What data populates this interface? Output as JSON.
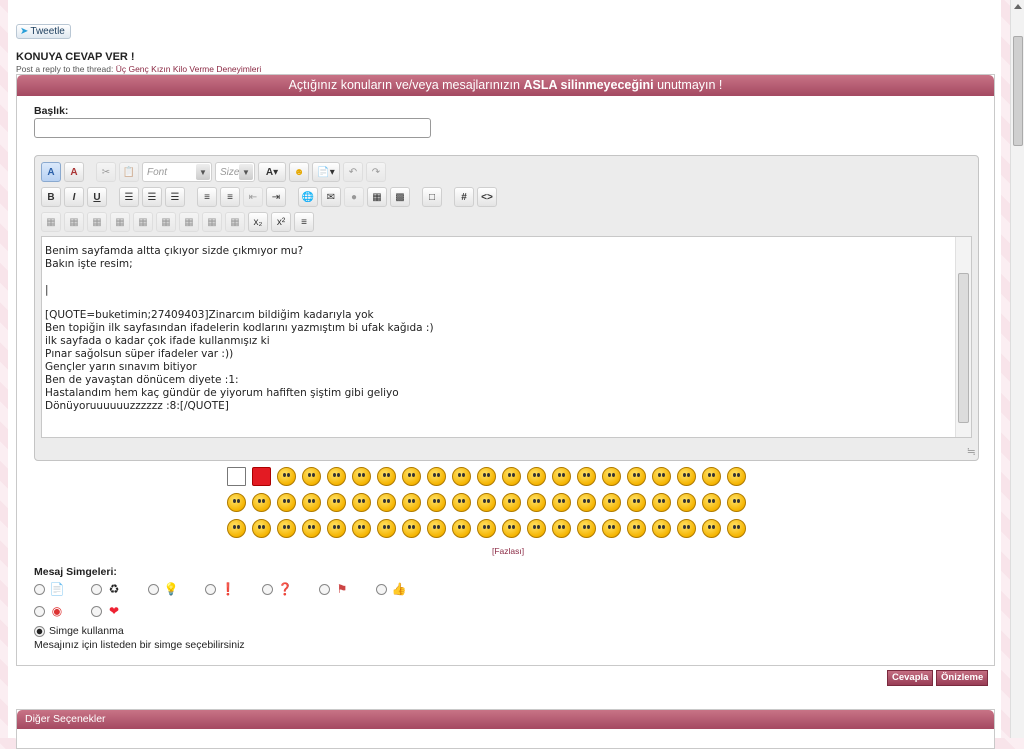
{
  "tweet": {
    "label": "Tweetle",
    "icon": "twitter-bird-icon"
  },
  "header": {
    "title": "KONUYA CEVAP VER !",
    "subtitle_prefix": "Post a reply to the thread:",
    "thread_link": "Üç Genç Kızın Kilo Verme Deneyimleri"
  },
  "notice": {
    "pre": "Açtığınız konuların ve/veya mesajlarınızın",
    "strong": "ASLA silinmeyeceğini",
    "post": "unutmayın !"
  },
  "title_field": {
    "label": "Başlık:",
    "value": ""
  },
  "toolbar": {
    "font_placeholder": "Font",
    "size_placeholder": "Size",
    "row1_icons": [
      "wysiwyg-mode-icon",
      "source-mode-icon",
      "cut-icon",
      "paste-icon",
      "font-select",
      "size-select",
      "text-color-icon",
      "smilie-icon",
      "paste-special-icon",
      "undo-icon",
      "redo-icon"
    ],
    "row2_icons": [
      "bold-icon",
      "italic-icon",
      "underline-icon",
      "align-left-icon",
      "align-center-icon",
      "align-right-icon",
      "ordered-list-icon",
      "unordered-list-icon",
      "outdent-icon",
      "indent-icon",
      "link-icon",
      "email-icon",
      "unlink-icon",
      "image-icon",
      "video-icon",
      "quote-icon",
      "hash-icon",
      "code-icon"
    ],
    "row3_icons": [
      "table-icon",
      "insert-row-icon",
      "delete-row-icon",
      "insert-col-icon",
      "delete-col-icon",
      "merge-icon",
      "split-icon",
      "cell-props-icon",
      "table-props-icon",
      "subscript-icon",
      "superscript-icon",
      "strike-icon"
    ]
  },
  "message": {
    "lines": [
      "Benim sayfamda altta çıkıyor sizde çıkmıyor mu?",
      "Bakın işte resim;",
      "",
      "|",
      "",
      "[QUOTE=buketimin;27409403]Zinarcım bildiğim kadarıyla yok",
      "Ben topiğin ilk sayfasından ifadelerin kodlarını yazmıştım bi ufak kağıda :)",
      "ilk sayfada o kadar çok ifade kullanmışız ki",
      "Pınar sağolsun süper ifadeler var :))",
      "Gençler yarın sınavım bitiyor",
      "Ben de yavaştan dönücem diyete :1:",
      "Hastalandım hem kaç gündür de yiyorum hafiften şiştim gibi geliyo",
      "Dönüyoruuuuuuzzzzzz :8:[/QUOTE]"
    ]
  },
  "smilies": {
    "rows": [
      21,
      21,
      21
    ],
    "more_label": "[Fazlası]"
  },
  "post_icons": {
    "label": "Mesaj Simgeleri:",
    "row1": [
      "document-icon",
      "recycle-icon",
      "lightbulb-icon",
      "exclamation-icon",
      "question-icon",
      "flag-icon",
      "thumbs-icon"
    ],
    "row2": [
      "lifebuoy-icon",
      "heart-icon"
    ],
    "no_icon_label": "Simge kullanma",
    "hint": "Mesajınız için listeden bir simge seçebilirsiniz"
  },
  "buttons": {
    "submit": "Cevapla",
    "preview": "Önizleme"
  },
  "other_options": {
    "title": "Diğer Seçenekler"
  },
  "colors": {
    "accent": "#a44961",
    "link": "#8b2a44"
  }
}
